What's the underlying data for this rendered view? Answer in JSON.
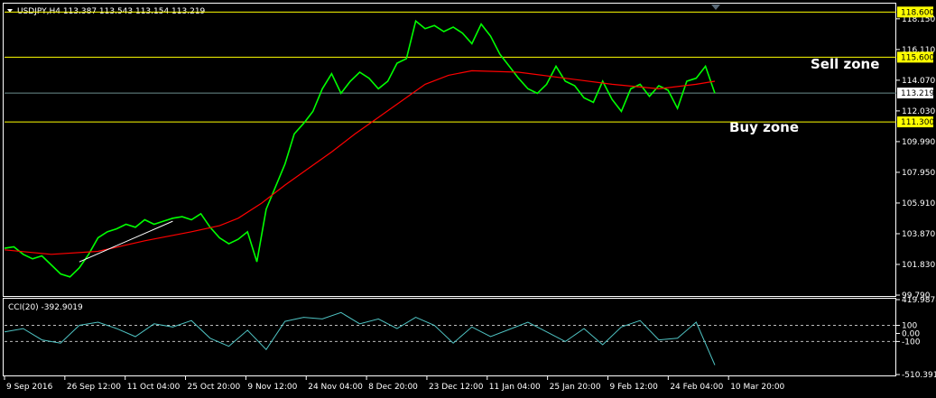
{
  "chart_data": [
    {
      "type": "line",
      "symbol_header": "USDJPY,H4  113.387 113.543 113.154 113.219",
      "yticks": [
        118.15,
        116.11,
        114.07,
        112.03,
        109.99,
        107.95,
        105.91,
        103.87,
        101.83,
        99.79
      ],
      "ylim": [
        99.79,
        119.1
      ],
      "xticks": [
        "9 Sep 2016",
        "26 Sep 12:00",
        "11 Oct 04:00",
        "25 Oct 20:00",
        "9 Nov 12:00",
        "24 Nov 04:00",
        "8 Dec 20:00",
        "23 Dec 12:00",
        "11 Jan 04:00",
        "25 Jan 20:00",
        "9 Feb 12:00",
        "24 Feb 04:00",
        "10 Mar 20:00"
      ],
      "level_lines": [
        {
          "label": "118.600",
          "value": 118.6,
          "color": "#ffff00"
        },
        {
          "label": "115.600",
          "value": 115.6,
          "color": "#ffff00"
        },
        {
          "label": "111.300",
          "value": 111.3,
          "color": "#ffff00"
        }
      ],
      "current_price": {
        "label": "113.219",
        "value": 113.219
      },
      "annotations": {
        "sell_zone": "Sell zone",
        "buy_zone": "Buy zone"
      },
      "trendline": {
        "from": {
          "x": 16,
          "y": 102.0
        },
        "to": {
          "x": 36,
          "y": 104.7
        }
      },
      "series": [
        {
          "color": "#00ff00",
          "x": [
            0,
            2,
            4,
            6,
            8,
            10,
            12,
            14,
            16,
            18,
            20,
            22,
            24,
            26,
            28,
            30,
            32,
            34,
            36,
            38,
            40,
            42,
            44,
            46,
            48,
            50,
            52,
            54,
            56,
            58,
            60,
            62,
            64,
            66,
            68,
            70,
            72,
            74,
            76,
            78,
            80,
            82,
            84,
            86,
            88,
            90,
            92,
            94,
            96,
            98,
            100,
            102,
            104,
            106,
            108,
            110,
            112,
            114,
            116,
            118,
            120,
            122,
            124,
            126,
            128,
            130,
            132,
            134,
            136,
            138,
            140,
            142,
            144,
            146,
            148,
            150,
            152
          ],
          "y": [
            102.9,
            103.0,
            102.5,
            102.2,
            102.4,
            101.8,
            101.2,
            101.0,
            101.6,
            102.5,
            103.6,
            104.0,
            104.2,
            104.5,
            104.3,
            104.8,
            104.5,
            104.7,
            104.9,
            105.0,
            104.8,
            105.2,
            104.3,
            103.6,
            103.2,
            103.5,
            104.0,
            102.0,
            105.5,
            107.0,
            108.5,
            110.5,
            111.2,
            112.0,
            113.5,
            114.5,
            113.2,
            114.0,
            114.6,
            114.2,
            113.5,
            114.0,
            115.2,
            115.5,
            118.0,
            117.5,
            117.7,
            117.3,
            117.6,
            117.2,
            116.5,
            117.8,
            117.0,
            115.8,
            115.0,
            114.2,
            113.5,
            113.2,
            113.8,
            115.0,
            114.0,
            113.7,
            112.9,
            112.6,
            114.0,
            112.8,
            112.0,
            113.5,
            113.8,
            113.0,
            113.7,
            113.4,
            112.2,
            114.0,
            114.2,
            115.0,
            113.2
          ],
          "name": ""
        },
        {
          "color": "#ff0000",
          "x": [
            0,
            10,
            20,
            30,
            40,
            46,
            50,
            55,
            60,
            65,
            70,
            75,
            80,
            85,
            90,
            95,
            100,
            110,
            120,
            130,
            140,
            148,
            152
          ],
          "y": [
            102.8,
            102.5,
            102.7,
            103.4,
            104.0,
            104.4,
            104.9,
            105.9,
            107.1,
            108.2,
            109.3,
            110.5,
            111.6,
            112.7,
            113.8,
            114.4,
            114.7,
            114.6,
            114.2,
            113.8,
            113.5,
            113.8,
            114.0
          ],
          "name": ""
        }
      ]
    },
    {
      "type": "line",
      "title": "CCI(20) -392.9019",
      "yticks": [
        {
          "label": "419.9878",
          "value": 419.9878
        },
        {
          "label": "100",
          "value": 100
        },
        {
          "label": "0.00",
          "value": 0
        },
        {
          "label": "-100",
          "value": -100
        },
        {
          "label": "-510.3919",
          "value": -510.3919
        }
      ],
      "ylim": [
        -510.3919,
        419.9878
      ],
      "dashed_levels": [
        100,
        -100
      ],
      "series": [
        {
          "color": "#4fc3c3",
          "x": [
            0,
            4,
            8,
            12,
            16,
            20,
            24,
            28,
            32,
            36,
            40,
            44,
            48,
            52,
            56,
            60,
            64,
            68,
            72,
            76,
            80,
            84,
            88,
            92,
            96,
            100,
            104,
            108,
            112,
            116,
            120,
            124,
            128,
            132,
            136,
            140,
            144,
            148,
            152
          ],
          "y": [
            20,
            60,
            -80,
            -120,
            100,
            140,
            60,
            -40,
            120,
            80,
            160,
            -60,
            -160,
            40,
            -200,
            150,
            200,
            180,
            260,
            120,
            180,
            60,
            200,
            100,
            -120,
            80,
            -40,
            50,
            140,
            20,
            -100,
            60,
            -140,
            80,
            160,
            -80,
            -60,
            140,
            -392.9
          ],
          "name": ""
        }
      ]
    }
  ],
  "palette": {
    "background": "#000000",
    "axis": "#ffffff",
    "level": "#ffff00",
    "price_line": "#6b8e8e",
    "tag_bg": "#ffff00",
    "current_tag_bg": "#ffffff"
  }
}
